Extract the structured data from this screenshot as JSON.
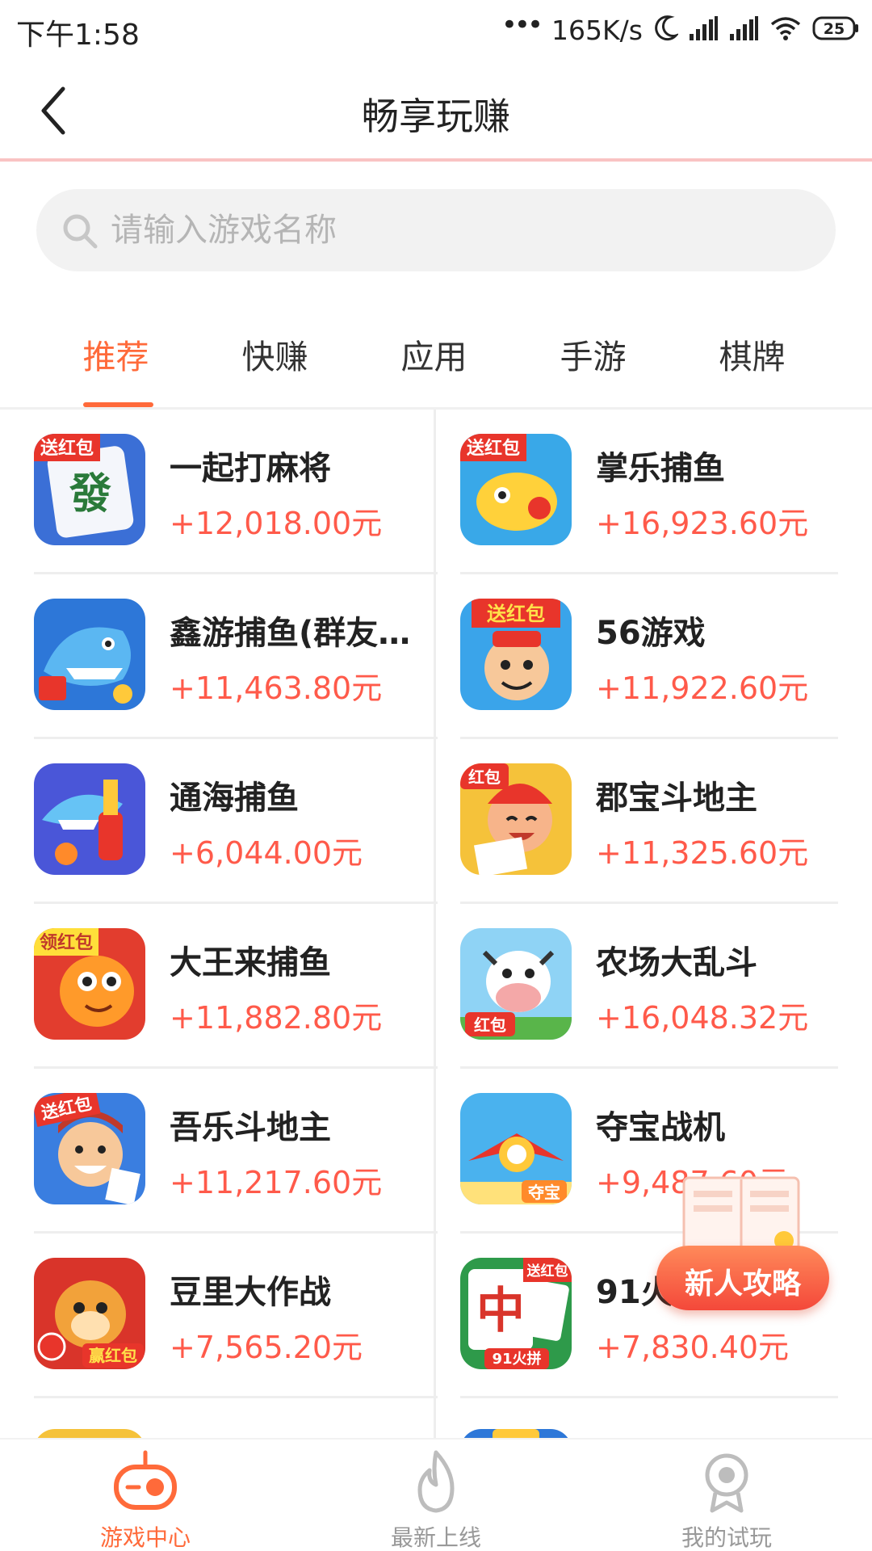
{
  "status_bar": {
    "time": "下午1:58",
    "speed": "165K/s",
    "battery": "25"
  },
  "header": {
    "title": "畅享玩赚"
  },
  "search": {
    "placeholder": "请输入游戏名称"
  },
  "tabs": [
    {
      "label": "推荐",
      "active": true
    },
    {
      "label": "快赚",
      "active": false
    },
    {
      "label": "应用",
      "active": false
    },
    {
      "label": "手游",
      "active": false
    },
    {
      "label": "棋牌",
      "active": false
    }
  ],
  "games": [
    {
      "name": "一起打麻将",
      "reward": "+12,018.00元",
      "icon": "mahjong-icon",
      "badge": "送红包"
    },
    {
      "name": "掌乐捕鱼",
      "reward": "+16,923.60元",
      "icon": "fish-icon",
      "badge": "送红包"
    },
    {
      "name": "鑫游捕鱼(群友...",
      "reward": "+11,463.80元",
      "icon": "shark-icon",
      "badge": ""
    },
    {
      "name": "56游戏",
      "reward": "+11,922.60元",
      "icon": "fortune-god-icon",
      "badge": "送红包"
    },
    {
      "name": "通海捕鱼",
      "reward": "+6,044.00元",
      "icon": "shark-blue-icon",
      "badge": ""
    },
    {
      "name": "郡宝斗地主",
      "reward": "+11,325.60元",
      "icon": "cards-boy-icon",
      "badge": "红包"
    },
    {
      "name": "大王来捕鱼",
      "reward": "+11,882.80元",
      "icon": "goldfish-icon",
      "badge": "领红包"
    },
    {
      "name": "农场大乱斗",
      "reward": "+16,048.32元",
      "icon": "cow-icon",
      "badge": "红包"
    },
    {
      "name": "吾乐斗地主",
      "reward": "+11,217.60元",
      "icon": "landlord-icon",
      "badge": "送红包"
    },
    {
      "name": "夺宝战机",
      "reward": "+9,487.60元",
      "icon": "fighter-plane-icon",
      "badge": "夺宝"
    },
    {
      "name": "豆里大作战",
      "reward": "+7,565.20元",
      "icon": "hamster-icon",
      "badge": "赢红包"
    },
    {
      "name": "91火拼",
      "reward": "+7,830.40元",
      "icon": "zhong-tile-icon",
      "badge": "送红包"
    }
  ],
  "guide": {
    "label": "新人攻略"
  },
  "bottom_nav": [
    {
      "label": "游戏中心",
      "icon": "gamepad-icon",
      "active": true
    },
    {
      "label": "最新上线",
      "icon": "flame-icon",
      "active": false
    },
    {
      "label": "我的试玩",
      "icon": "user-icon",
      "active": false
    }
  ],
  "colors": {
    "accent": "#ff6a3a",
    "reward": "#ff5a4a",
    "header_divider": "#f9c3c3"
  }
}
